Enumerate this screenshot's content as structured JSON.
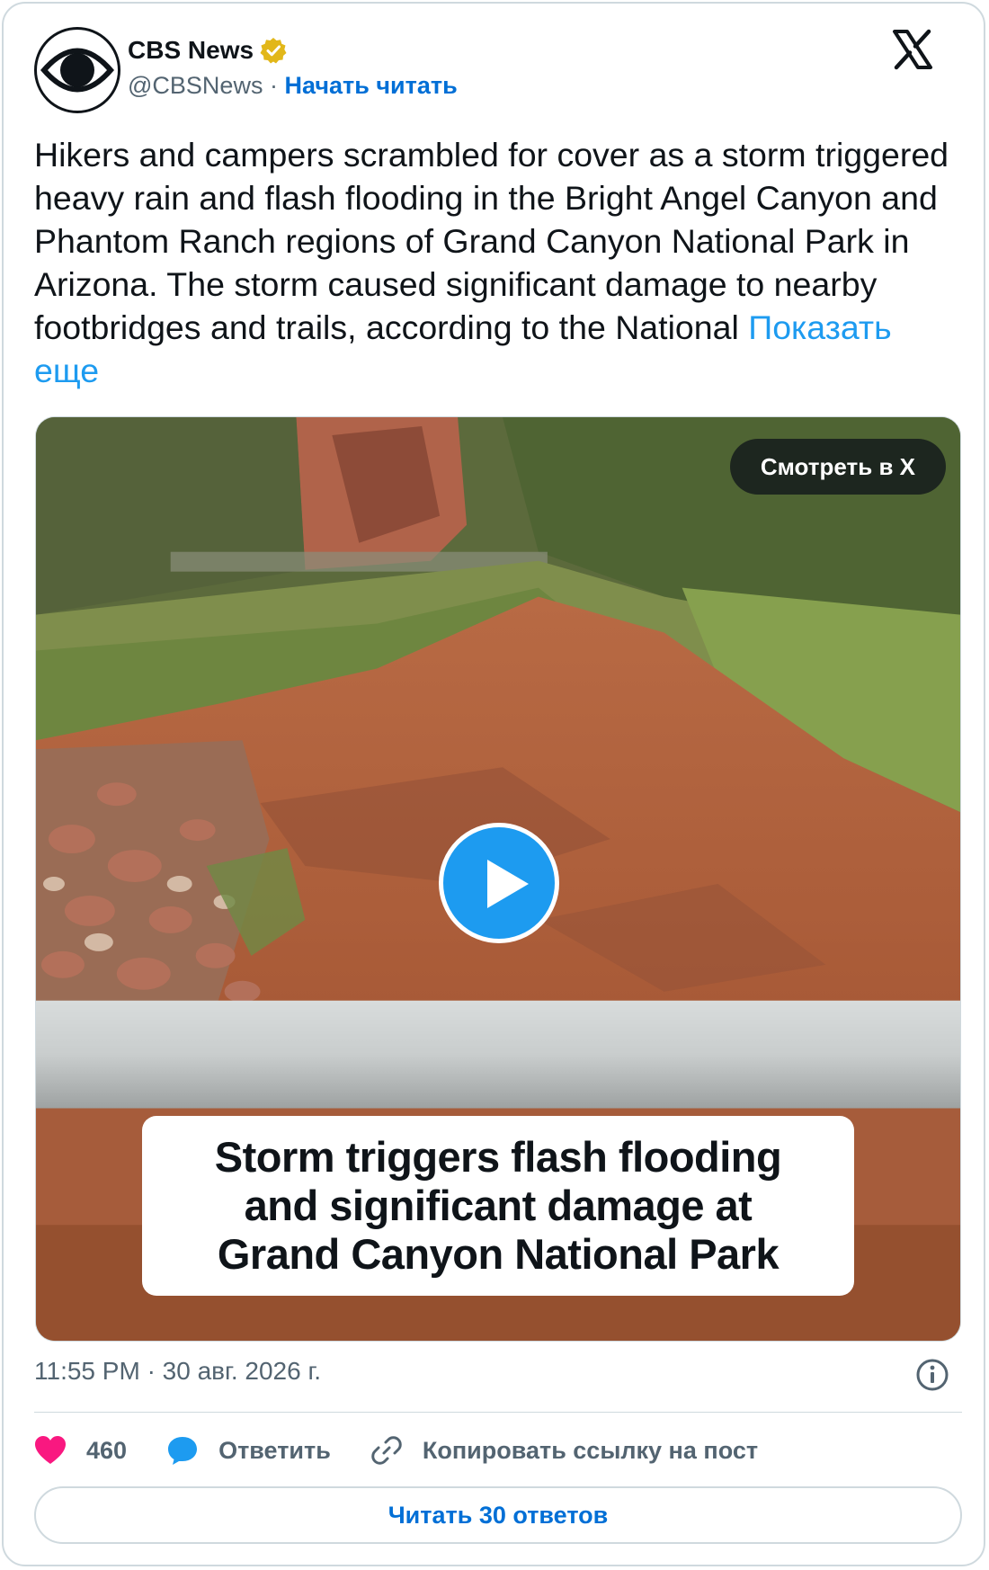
{
  "author": {
    "name": "CBS News",
    "handle": "@CBSNews",
    "separator": "·",
    "follow_label": "Начать читать",
    "verified_icon": "verified-badge-icon",
    "avatar_icon": "cbs-eye-logo"
  },
  "platform_icon": "x-logo-icon",
  "tweet": {
    "text": "Hikers and campers scrambled for cover as a storm triggered heavy rain and flash flooding in the Bright Angel Canyon and Phantom Ranch regions of Grand Canyon National Park in Arizona. The storm caused significant damage to nearby footbridges and trails, according to the National ",
    "show_more": "Показать еще"
  },
  "media": {
    "watch_label": "Смотреть в X",
    "play_icon": "play-icon",
    "caption_lines": [
      "Storm triggers flash flooding",
      "and significant damage at",
      "Grand Canyon National Park"
    ]
  },
  "meta": {
    "time": "11:55 PM",
    "separator": "·",
    "date": "30 авг. 2026 г.",
    "info_icon": "info-icon"
  },
  "actions": {
    "likes": "460",
    "reply_label": "Ответить",
    "copy_label": "Копировать ссылку на пост"
  },
  "read_replies_label": "Читать 30 ответов",
  "colors": {
    "link": "#1d9bf0",
    "follow": "#006fd6",
    "like": "#f91880",
    "play": "#1d9bf0",
    "muted": "#536471",
    "border": "#cfd9de"
  }
}
